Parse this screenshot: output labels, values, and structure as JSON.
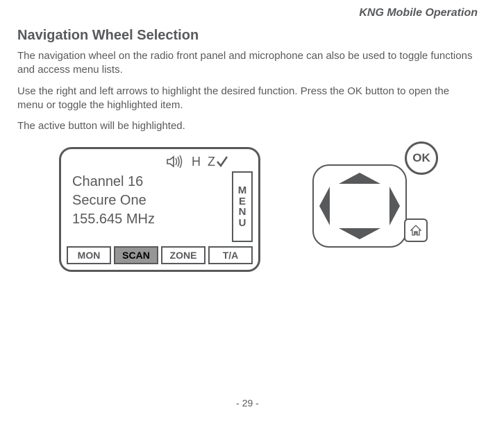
{
  "header": {
    "right": "KNG Mobile Operation"
  },
  "section": {
    "title": "Navigation Wheel Selection",
    "para1": "The navigation wheel on the radio front panel and microphone can also be used to toggle functions and access menu lists.",
    "para2": "Use the right and left arrows to highlight the desired function. Press the OK button to open the menu or toggle the highlighted item.",
    "para3": "The active button will be highlighted."
  },
  "display": {
    "status": {
      "h_label": "H",
      "z_label": "Z"
    },
    "line1": "Channel 16",
    "line2": "Secure One",
    "line3": "155.645 MHz",
    "side_menu": [
      "M",
      "E",
      "N",
      "U"
    ],
    "buttons": {
      "mon": "MON",
      "scan": "SCAN",
      "zone": "ZONE",
      "ta": "T/A"
    }
  },
  "control": {
    "ok_label": "OK"
  },
  "page_number": "- 29 -"
}
